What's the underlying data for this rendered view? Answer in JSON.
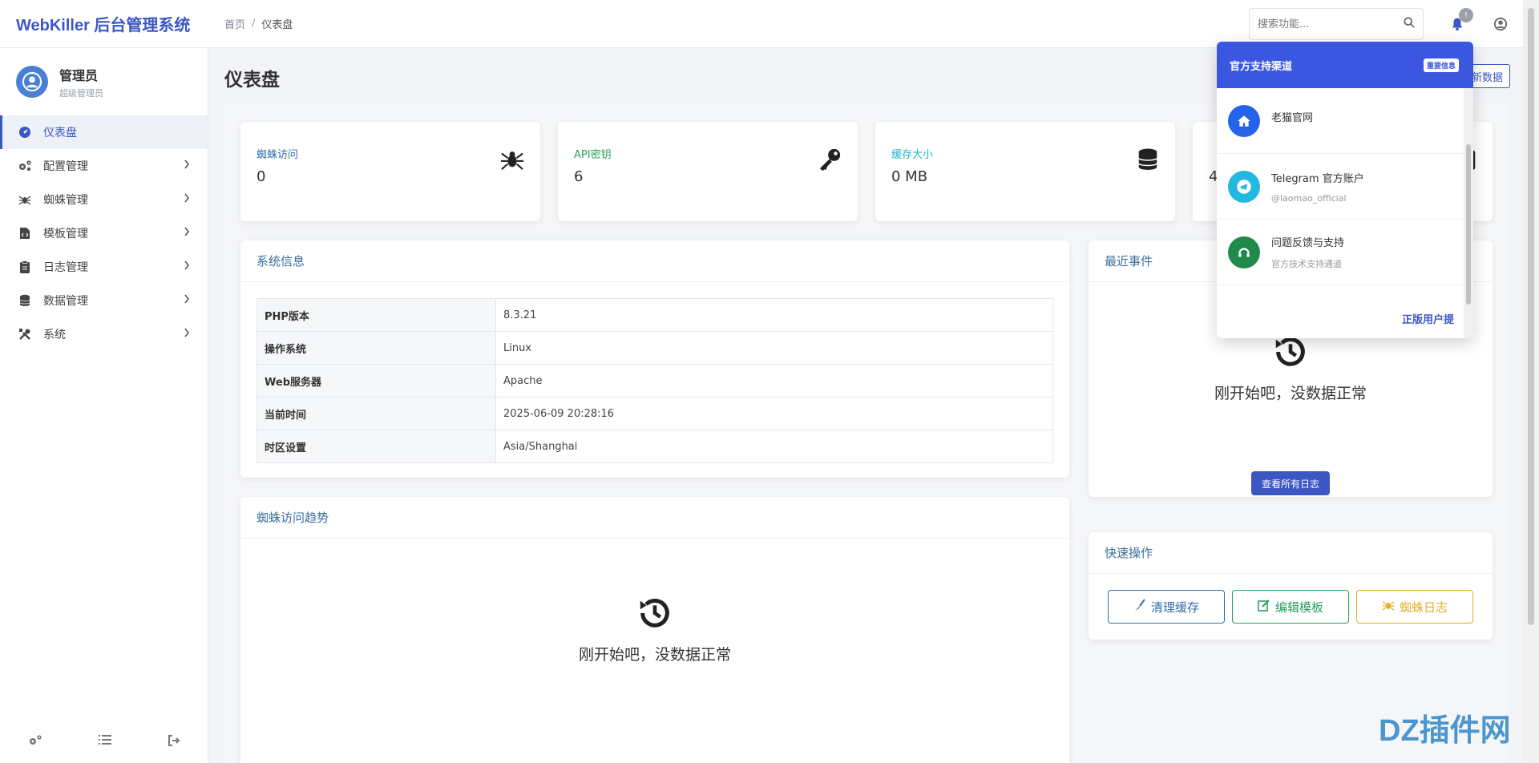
{
  "app": {
    "brand": "WebKiller 后台管理系统"
  },
  "breadcrumb": {
    "home": "首页",
    "separator": "/",
    "current": "仪表盘"
  },
  "search": {
    "placeholder": "搜索功能..."
  },
  "notifications": {
    "badge": "!"
  },
  "user": {
    "name": "管理员",
    "role": "超级管理员"
  },
  "sidebar": {
    "items": [
      {
        "label": "仪表盘",
        "icon": "dashboard-icon",
        "active": true
      },
      {
        "label": "配置管理",
        "icon": "cogs-icon"
      },
      {
        "label": "蜘蛛管理",
        "icon": "spider-icon"
      },
      {
        "label": "模板管理",
        "icon": "file-code-icon"
      },
      {
        "label": "日志管理",
        "icon": "clipboard-icon"
      },
      {
        "label": "数据管理",
        "icon": "database-icon"
      },
      {
        "label": "系统",
        "icon": "tools-icon"
      }
    ]
  },
  "page": {
    "title": "仪表盘",
    "refresh_label": "新数据"
  },
  "stats": [
    {
      "label": "蜘蛛访问",
      "value": "0",
      "icon": "spider-icon",
      "color": "#2f6da8"
    },
    {
      "label": "API密钥",
      "value": "6",
      "icon": "key-icon",
      "color": "#28a060"
    },
    {
      "label": "缓存大小",
      "value": "0 MB",
      "icon": "database-icon",
      "color": "#1fb3c9"
    },
    {
      "label": "",
      "value": "4",
      "icon": "clipboard-icon",
      "color": "#e0b020"
    }
  ],
  "system_info": {
    "title": "系统信息",
    "rows": [
      {
        "key": "PHP版本",
        "value": "8.3.21"
      },
      {
        "key": "操作系统",
        "value": "Linux"
      },
      {
        "key": "Web服务器",
        "value": "Apache"
      },
      {
        "key": "当前时间",
        "value": "2025-06-09 20:28:16"
      },
      {
        "key": "时区设置",
        "value": "Asia/Shanghai"
      }
    ]
  },
  "trend": {
    "title": "蜘蛛访问趋势",
    "empty_text": "刚开始吧，没数据正常"
  },
  "events": {
    "title": "最近事件",
    "empty_text": "刚开始吧，没数据正常",
    "view_all": "查看所有日志"
  },
  "quick": {
    "title": "快速操作",
    "buttons": [
      {
        "label": "清理缓存",
        "color": "#2f6da8"
      },
      {
        "label": "编辑模板",
        "color": "#28a060"
      },
      {
        "label": "蜘蛛日志",
        "color": "#e0b020"
      }
    ]
  },
  "dropdown": {
    "title": "官方支持渠道",
    "tag": "重要信息",
    "items": [
      {
        "title": "老猫官网",
        "sub": "",
        "icon": "home-icon",
        "color": "#2563eb"
      },
      {
        "title": "Telegram 官方账户",
        "sub": "@laomao_official",
        "icon": "telegram-icon",
        "color": "#22b8e0"
      },
      {
        "title": "问题反馈与支持",
        "sub": "官方技术支持通道",
        "icon": "headset-icon",
        "color": "#1f8a4c"
      }
    ],
    "footer": "正版用户提"
  },
  "watermark": "DZ插件网"
}
